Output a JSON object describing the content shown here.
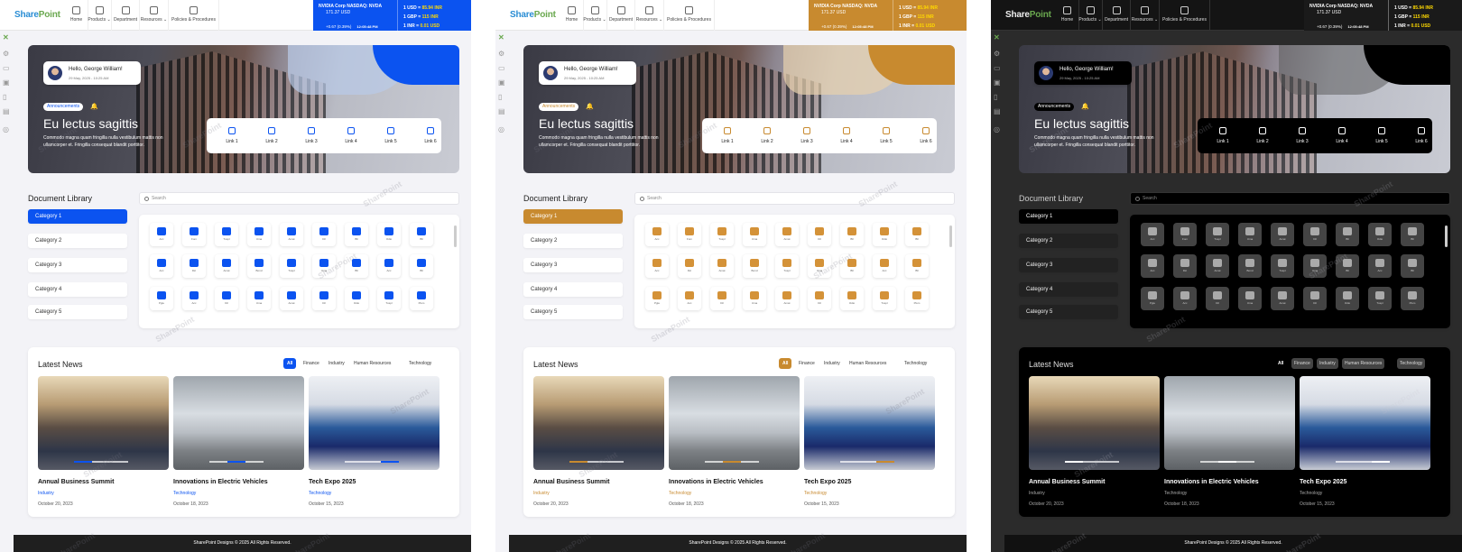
{
  "site": {
    "logo_main": "Share",
    "logo_accent": "Point"
  },
  "nav": [
    {
      "label": "Home",
      "icon": "home-icon"
    },
    {
      "label": "Products ⌄",
      "icon": "box-icon"
    },
    {
      "label": "Department",
      "icon": "building-icon"
    },
    {
      "label": "Resources ⌄",
      "icon": "book-icon"
    },
    {
      "label": "Policies & Procedures",
      "icon": "document-icon"
    }
  ],
  "ticker": {
    "stock_name": "NVIDIA Corp NASDAQ: NVDA",
    "price": "171.37 USD",
    "change": "+0.67 (0.39%)",
    "time": "12:05:48 PM",
    "rates": [
      {
        "label": "1 USD =",
        "value": "85.94 INR"
      },
      {
        "label": "1 GBP =",
        "value": "115 INR"
      },
      {
        "label": "1 INR =",
        "value": "0.01 USD"
      }
    ]
  },
  "hero": {
    "greeting": "Hello, George William!",
    "date": "29 May, 2025 - 10:25 AM",
    "badge": "Announcements",
    "title": "Eu lectus sagittis",
    "subtitle": "Commodo magna quam fringilla nulla vestibulum mattis non ullamcorper et. Fringilla consequat blandit porttitor.",
    "links": [
      "Link 1",
      "Link 2",
      "Link 3",
      "Link 4",
      "Link 5",
      "Link 6"
    ]
  },
  "library": {
    "title": "Document Library",
    "search_placeholder": "Search",
    "categories": [
      "Category 1",
      "Category 2",
      "Category 3",
      "Category 4",
      "Category 5"
    ],
    "tiles": [
      [
        "Acc",
        "Fom",
        "Tuspl",
        "Uma",
        "Amat",
        "Dil",
        "Bll",
        "Odio",
        "Bll"
      ],
      [
        "Acc",
        "Dic",
        "Amat",
        "Bond",
        "Tuspl",
        "Uma",
        "Bll",
        "Acc",
        "Bll"
      ],
      [
        "Pgle",
        "Acc",
        "Dil",
        "Uma",
        "Amat",
        "Dil",
        "Odio",
        "Tuspl",
        "Plum"
      ]
    ]
  },
  "news": {
    "title": "Latest News",
    "filters": [
      "All",
      "Finance",
      "Industry",
      "Human Resources",
      "Technology"
    ],
    "items": [
      {
        "headline": "Annual Business Summit",
        "category": "Industry",
        "date": "October 20, 2023"
      },
      {
        "headline": "Innovations in Electric Vehicles",
        "category": "Technology",
        "date": "October 18, 2023"
      },
      {
        "headline": "Tech Expo 2025",
        "category": "Technology",
        "date": "October 15, 2023"
      }
    ]
  },
  "footer": {
    "text": "SharePoint Designs © 2025 All Rights Reserved."
  },
  "watermark": "SharePoint",
  "themes": [
    {
      "name": "blue",
      "accent": "#0b53f0"
    },
    {
      "name": "orange",
      "accent": "#c88a2f"
    },
    {
      "name": "dark",
      "accent": "#000000"
    }
  ]
}
